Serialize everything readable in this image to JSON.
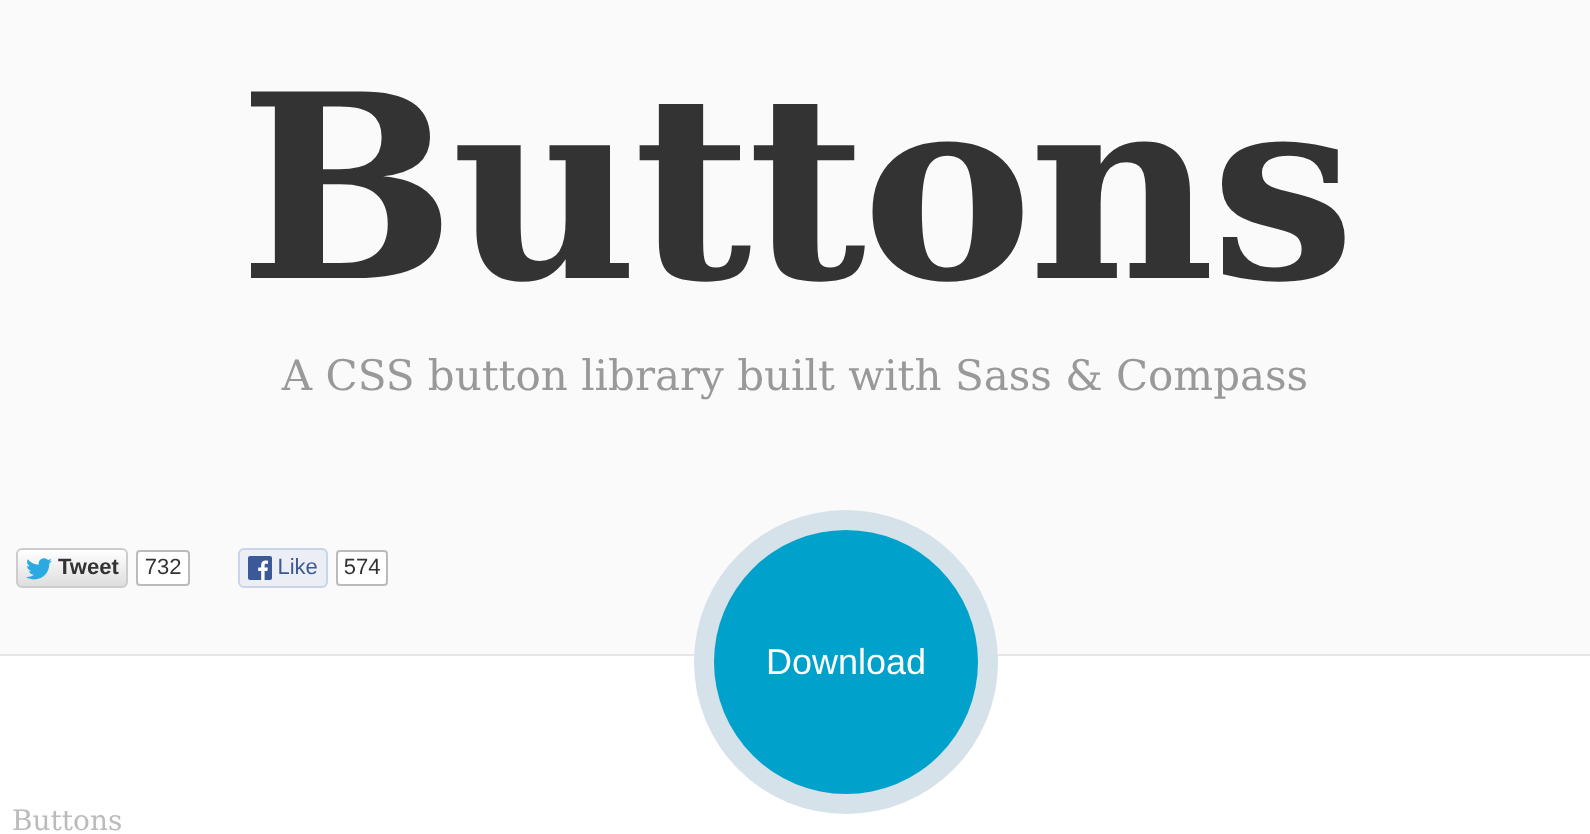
{
  "header": {
    "title": "Buttons",
    "subtitle": "A CSS button library built with Sass & Compass"
  },
  "social": [
    {
      "kind": "tweet",
      "label": "Tweet",
      "count": "732"
    },
    {
      "kind": "like",
      "label": "Like",
      "count": "574"
    }
  ],
  "download": {
    "label": "Download"
  },
  "section": {
    "heading": "Buttons"
  }
}
